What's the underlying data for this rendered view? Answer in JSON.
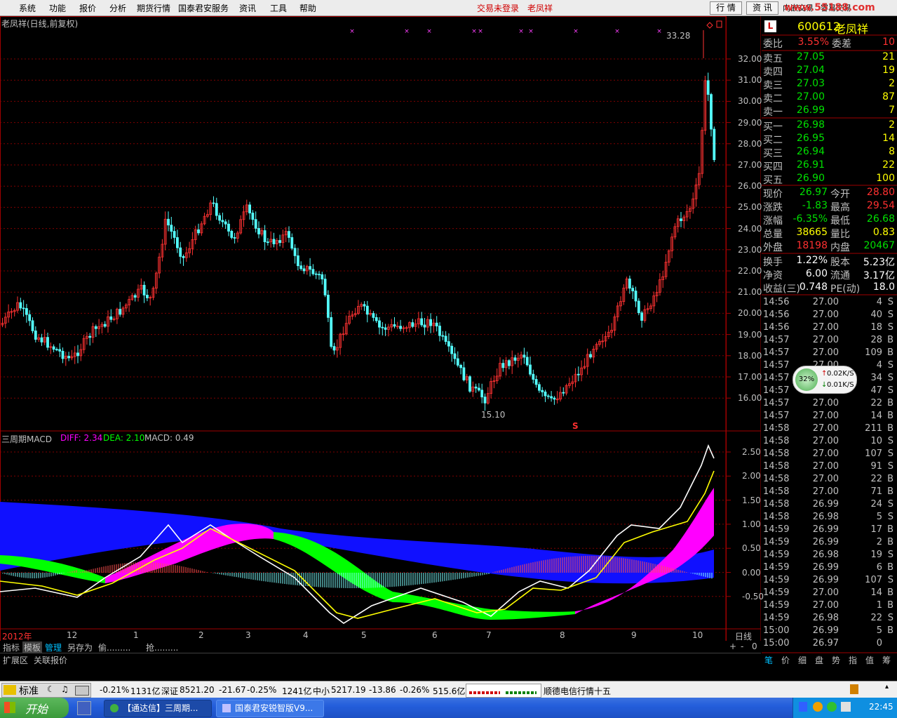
{
  "menubar": {
    "items": [
      "系统",
      "功能",
      "报价",
      "分析",
      "期货行情",
      "国泰君安服务",
      "资讯",
      "工具",
      "帮助"
    ],
    "trade_status": "交易未登录",
    "stock_name": "老凤祥",
    "btn_quote": "行 情",
    "btn_info": "资 讯",
    "btn_internal": "内嵌交易",
    "btn_trade": "容易交易",
    "watermark": "www.55188.com"
  },
  "chart": {
    "title": "老凤祥(日线,前复权)",
    "y_labels": [
      "32.00",
      "31.00",
      "30.00",
      "29.00",
      "28.00",
      "27.00",
      "26.00",
      "25.00",
      "24.00",
      "23.00",
      "22.00",
      "21.00",
      "20.00",
      "19.00",
      "18.00",
      "17.00",
      "16.00"
    ],
    "high_label": "33.28",
    "low_label": "15.10",
    "s_marker": "S",
    "cross_marker": "×"
  },
  "macd": {
    "title": "三周期MACD",
    "diff": "DIFF: 2.34",
    "dea": "DEA: 2.10",
    "macd": "MACD: 0.49",
    "y_labels": [
      "2.50",
      "2.00",
      "1.50",
      "1.00",
      "0.50",
      "0.00",
      "-0.50"
    ]
  },
  "xaxis": {
    "labels": [
      "2012年",
      "12",
      "1",
      "2",
      "3",
      "4",
      "5",
      "6",
      "7",
      "8",
      "9",
      "10"
    ],
    "period": "日线"
  },
  "tabs": {
    "items": [
      "指标",
      "模板",
      "管理",
      "另存为",
      "偷.........",
      "抢........."
    ],
    "ext": "扩展区",
    "link_quote": "关联报价"
  },
  "quote": {
    "badge": "L",
    "code": "600612",
    "name": "老凤祥",
    "wb_label": "委比",
    "wb_value": "3.55%",
    "wc_label": "委差",
    "wc_value": "10",
    "asks": [
      {
        "label": "卖五",
        "price": "27.05",
        "vol": "21"
      },
      {
        "label": "卖四",
        "price": "27.04",
        "vol": "19"
      },
      {
        "label": "卖三",
        "price": "27.03",
        "vol": "2"
      },
      {
        "label": "卖二",
        "price": "27.00",
        "vol": "87"
      },
      {
        "label": "卖一",
        "price": "26.99",
        "vol": "7"
      }
    ],
    "bids": [
      {
        "label": "买一",
        "price": "26.98",
        "vol": "2"
      },
      {
        "label": "买二",
        "price": "26.95",
        "vol": "14"
      },
      {
        "label": "买三",
        "price": "26.94",
        "vol": "8"
      },
      {
        "label": "买四",
        "price": "26.91",
        "vol": "22"
      },
      {
        "label": "买五",
        "price": "26.90",
        "vol": "100"
      }
    ],
    "stats": [
      {
        "l1": "现价",
        "v1": "26.97",
        "l2": "今开",
        "v2": "28.80"
      },
      {
        "l1": "涨跌",
        "v1": "-1.83",
        "l2": "最高",
        "v2": "29.54"
      },
      {
        "l1": "涨幅",
        "v1": "-6.35%",
        "l2": "最低",
        "v2": "26.68"
      },
      {
        "l1": "总量",
        "v1": "38665",
        "l2": "量比",
        "v2": "0.83"
      },
      {
        "l1": "外盘",
        "v1": "18198",
        "l2": "内盘",
        "v2": "20467"
      }
    ],
    "extra": [
      {
        "l1": "换手",
        "v1": "1.22%",
        "l2": "股本",
        "v2": "5.23亿"
      },
      {
        "l1": "净资",
        "v1": "6.00",
        "l2": "流通",
        "v2": "3.17亿"
      },
      {
        "l1": "收益(三)",
        "v1": "0.748",
        "l2": "PE(动)",
        "v2": "18.0"
      }
    ],
    "ticks": [
      {
        "t": "14:56",
        "p": "27.00",
        "v": "4",
        "d": "S"
      },
      {
        "t": "14:56",
        "p": "27.00",
        "v": "40",
        "d": "S"
      },
      {
        "t": "14:56",
        "p": "27.00",
        "v": "18",
        "d": "S"
      },
      {
        "t": "14:57",
        "p": "27.00",
        "v": "28",
        "d": "B"
      },
      {
        "t": "14:57",
        "p": "27.00",
        "v": "109",
        "d": "B"
      },
      {
        "t": "14:57",
        "p": "27.00",
        "v": "4",
        "d": "S"
      },
      {
        "t": "14:57",
        "p": "27.00",
        "v": "34",
        "d": "S"
      },
      {
        "t": "14:57",
        "p": "27.00",
        "v": "47",
        "d": "S"
      },
      {
        "t": "14:57",
        "p": "27.00",
        "v": "22",
        "d": "B"
      },
      {
        "t": "14:57",
        "p": "27.00",
        "v": "14",
        "d": "B"
      },
      {
        "t": "14:58",
        "p": "27.00",
        "v": "211",
        "d": "B"
      },
      {
        "t": "14:58",
        "p": "27.00",
        "v": "10",
        "d": "S"
      },
      {
        "t": "14:58",
        "p": "27.00",
        "v": "107",
        "d": "S"
      },
      {
        "t": "14:58",
        "p": "27.00",
        "v": "91",
        "d": "S"
      },
      {
        "t": "14:58",
        "p": "27.00",
        "v": "22",
        "d": "B"
      },
      {
        "t": "14:58",
        "p": "27.00",
        "v": "71",
        "d": "B"
      },
      {
        "t": "14:58",
        "p": "26.99",
        "v": "24",
        "d": "S"
      },
      {
        "t": "14:58",
        "p": "26.98",
        "v": "5",
        "d": "S"
      },
      {
        "t": "14:59",
        "p": "26.99",
        "v": "17",
        "d": "B"
      },
      {
        "t": "14:59",
        "p": "26.99",
        "v": "2",
        "d": "B"
      },
      {
        "t": "14:59",
        "p": "26.98",
        "v": "19",
        "d": "S"
      },
      {
        "t": "14:59",
        "p": "26.99",
        "v": "6",
        "d": "B"
      },
      {
        "t": "14:59",
        "p": "26.99",
        "v": "107",
        "d": "S"
      },
      {
        "t": "14:59",
        "p": "27.00",
        "v": "14",
        "d": "B"
      },
      {
        "t": "14:59",
        "p": "27.00",
        "v": "1",
        "d": "B"
      },
      {
        "t": "14:59",
        "p": "26.98",
        "v": "22",
        "d": "S"
      },
      {
        "t": "15:00",
        "p": "26.99",
        "v": "5",
        "d": "B"
      },
      {
        "t": "15:00",
        "p": "26.97",
        "v": "0",
        "d": ""
      }
    ],
    "speed": {
      "pct": "32%",
      "up": "0.02K/S",
      "down": "0.01K/S"
    },
    "bottom_tabs": [
      "笔",
      "价",
      "细",
      "盘",
      "势",
      "指",
      "值",
      "筹"
    ]
  },
  "status": {
    "std": "标准",
    "sh_pct": "-0.21%",
    "sh_amt": "1131亿",
    "sz_label": "深证",
    "sz_val": "8521.20",
    "sz_chg": "-21.67",
    "sz_pct": "-0.25%",
    "sz_amt": "1241亿",
    "zx_label": "中小",
    "zx_val": "5217.19",
    "zx_chg": "-13.86",
    "zx_pct": "-0.26%",
    "zx_amt": "515.6亿",
    "news": "顺德电信行情十五"
  },
  "taskbar": {
    "start": "开始",
    "task1": "【通达信】三周期...",
    "task2": "国泰君安锐智版V9...",
    "clock": "22:45"
  }
}
